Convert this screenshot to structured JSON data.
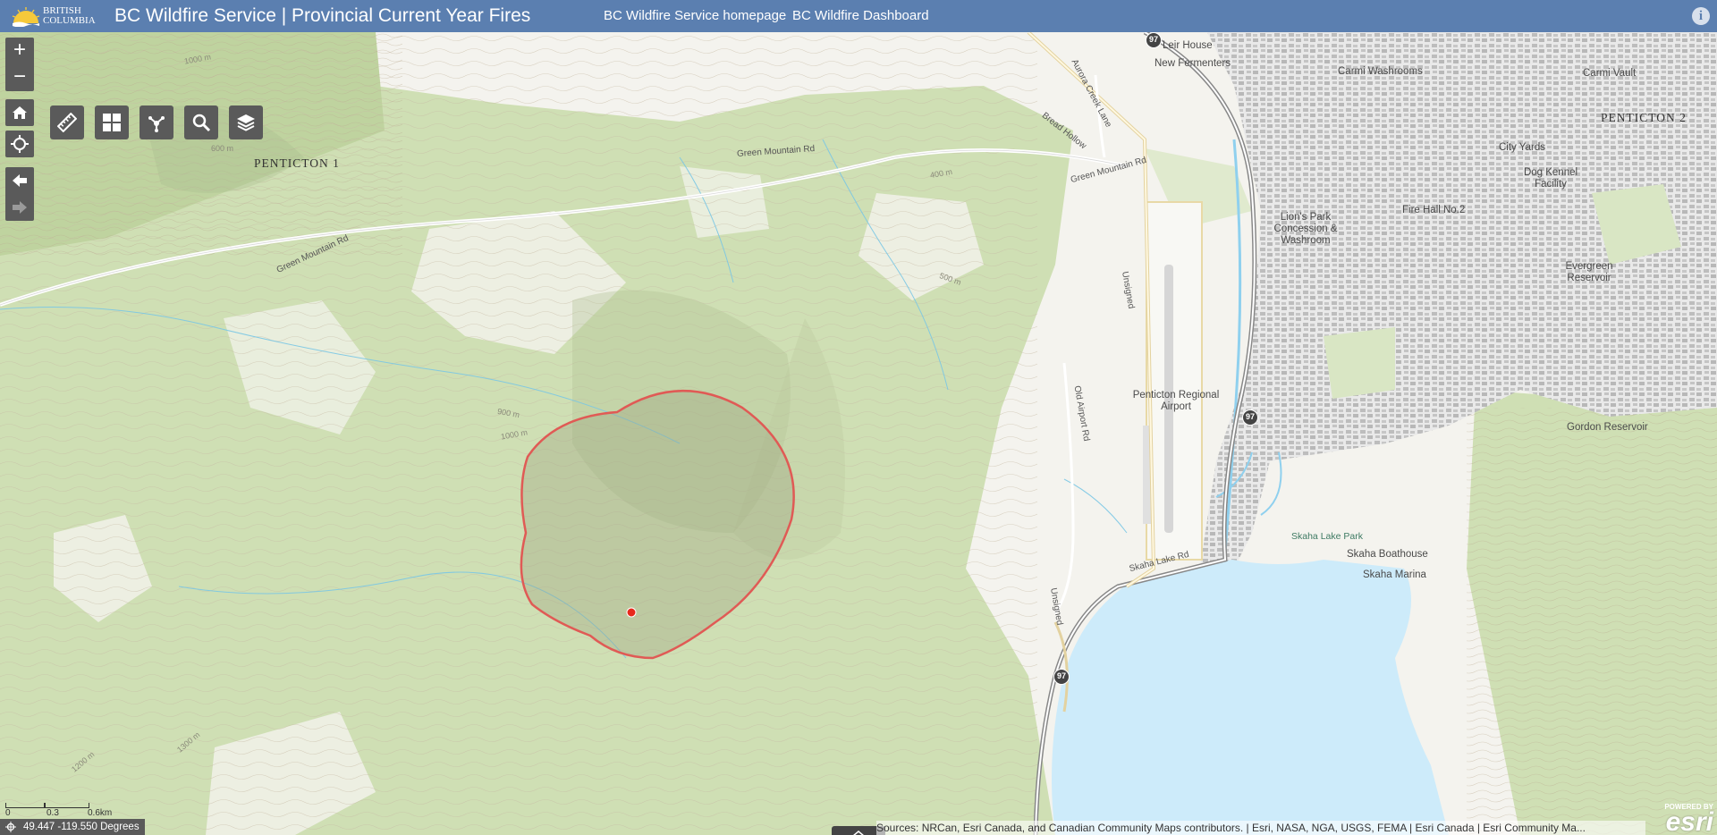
{
  "header": {
    "logo_line1": "BRITISH",
    "logo_line2": "COLUMBIA",
    "title": "BC Wildfire Service | Provincial Current Year Fires",
    "links": [
      "BC Wildfire Service homepage",
      "BC Wildfire Dashboard"
    ],
    "info_icon": "i"
  },
  "map": {
    "controls": {
      "zoom_in": "+",
      "zoom_out": "−",
      "side_buttons": [
        "home-icon",
        "locate-icon",
        "back-arrow-icon",
        "forward-arrow-icon"
      ],
      "tools": [
        "measure-icon",
        "basemap-gallery-icon",
        "share-icon",
        "search-icon",
        "layers-icon"
      ]
    },
    "labels": {
      "places": [
        "PENTICTON 1",
        "PENTICTON 2"
      ],
      "pois": [
        "Leir House",
        "New Fermenters",
        "Carmi Washrooms",
        "Carmi Vault",
        "City Yards",
        "Dog Kennel Facility",
        "Fire Hall No.2",
        "Lion's Park Concession & Washroom",
        "Evergreen Reservoir",
        "Penticton Regional Airport",
        "Gordon Reservoir",
        "Skaha Boathouse",
        "Skaha Marina"
      ],
      "parks": [
        "Skaha Lake Park"
      ],
      "roads": [
        "Green Mountain Rd",
        "Green Mountain Rd",
        "Green Mountain Rd",
        "Aurora Creek Lane",
        "Bread Hollow",
        "Unsigned",
        "Old Airport Rd",
        "Skaha Lake Rd",
        "Unsigned"
      ],
      "contours": [
        "400 m",
        "600 m",
        "1000 m",
        "500 m",
        "900 m",
        "1000 m",
        "1200 m",
        "1300 m"
      ],
      "highways": [
        "97",
        "97",
        "97"
      ]
    },
    "fire": {
      "perimeter_color": "#e05a55",
      "point_color": "#e8291c"
    },
    "scale": {
      "ticks": [
        "0",
        "0.3",
        "0.6km"
      ]
    },
    "coordinates": "49.447 -119.550 Degrees",
    "attribution": "Sources: NRCan, Esri Canada, and Canadian Community Maps contributors. | Esri, NASA, NGA, USGS, FEMA | Esri Canada | Esri Community Ma...",
    "esri": {
      "powered_by": "POWERED BY",
      "brand": "esri"
    }
  },
  "colors": {
    "header_bg": "#5b7fb0",
    "water": "#cdebfa",
    "forest": "#cfdfb4",
    "control_bg": "#5a5a5a"
  }
}
